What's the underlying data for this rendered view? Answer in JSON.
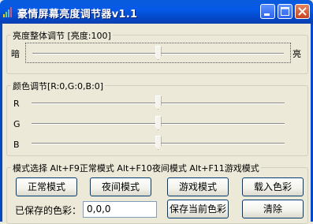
{
  "window": {
    "title": "豪情屏幕亮度调节器v1.1",
    "icons": {
      "app": "signal-bars-icon",
      "minimize": "minimize-icon",
      "maximize": "maximize-icon",
      "close": "close-icon"
    }
  },
  "brightness": {
    "title": "亮度整体调节 [亮度:100]",
    "left_label": "暗",
    "right_label": "亮",
    "level_fraction": 0.5
  },
  "color": {
    "title": "颜色调节[R:0,G:0,B:0]",
    "sliders": [
      {
        "label": "R",
        "level_fraction": 0.5
      },
      {
        "label": "G",
        "level_fraction": 0.5
      },
      {
        "label": "B",
        "level_fraction": 0.5
      }
    ]
  },
  "mode": {
    "title": "模式选择 Alt+F9正常模式 Alt+F10夜间模式 Alt+F11游戏模式",
    "buttons": {
      "normal": "正常模式",
      "night": "夜间模式",
      "game": "游戏模式",
      "load": "载入色彩"
    },
    "saved_label": "已保存的色彩：",
    "saved_value": "0,0,0",
    "save_button": "保存当前色彩",
    "clear_button": "清除"
  },
  "colors": {
    "titlebar": "#0559e6",
    "face": "#ece9d8",
    "close_button": "#c8431e"
  }
}
